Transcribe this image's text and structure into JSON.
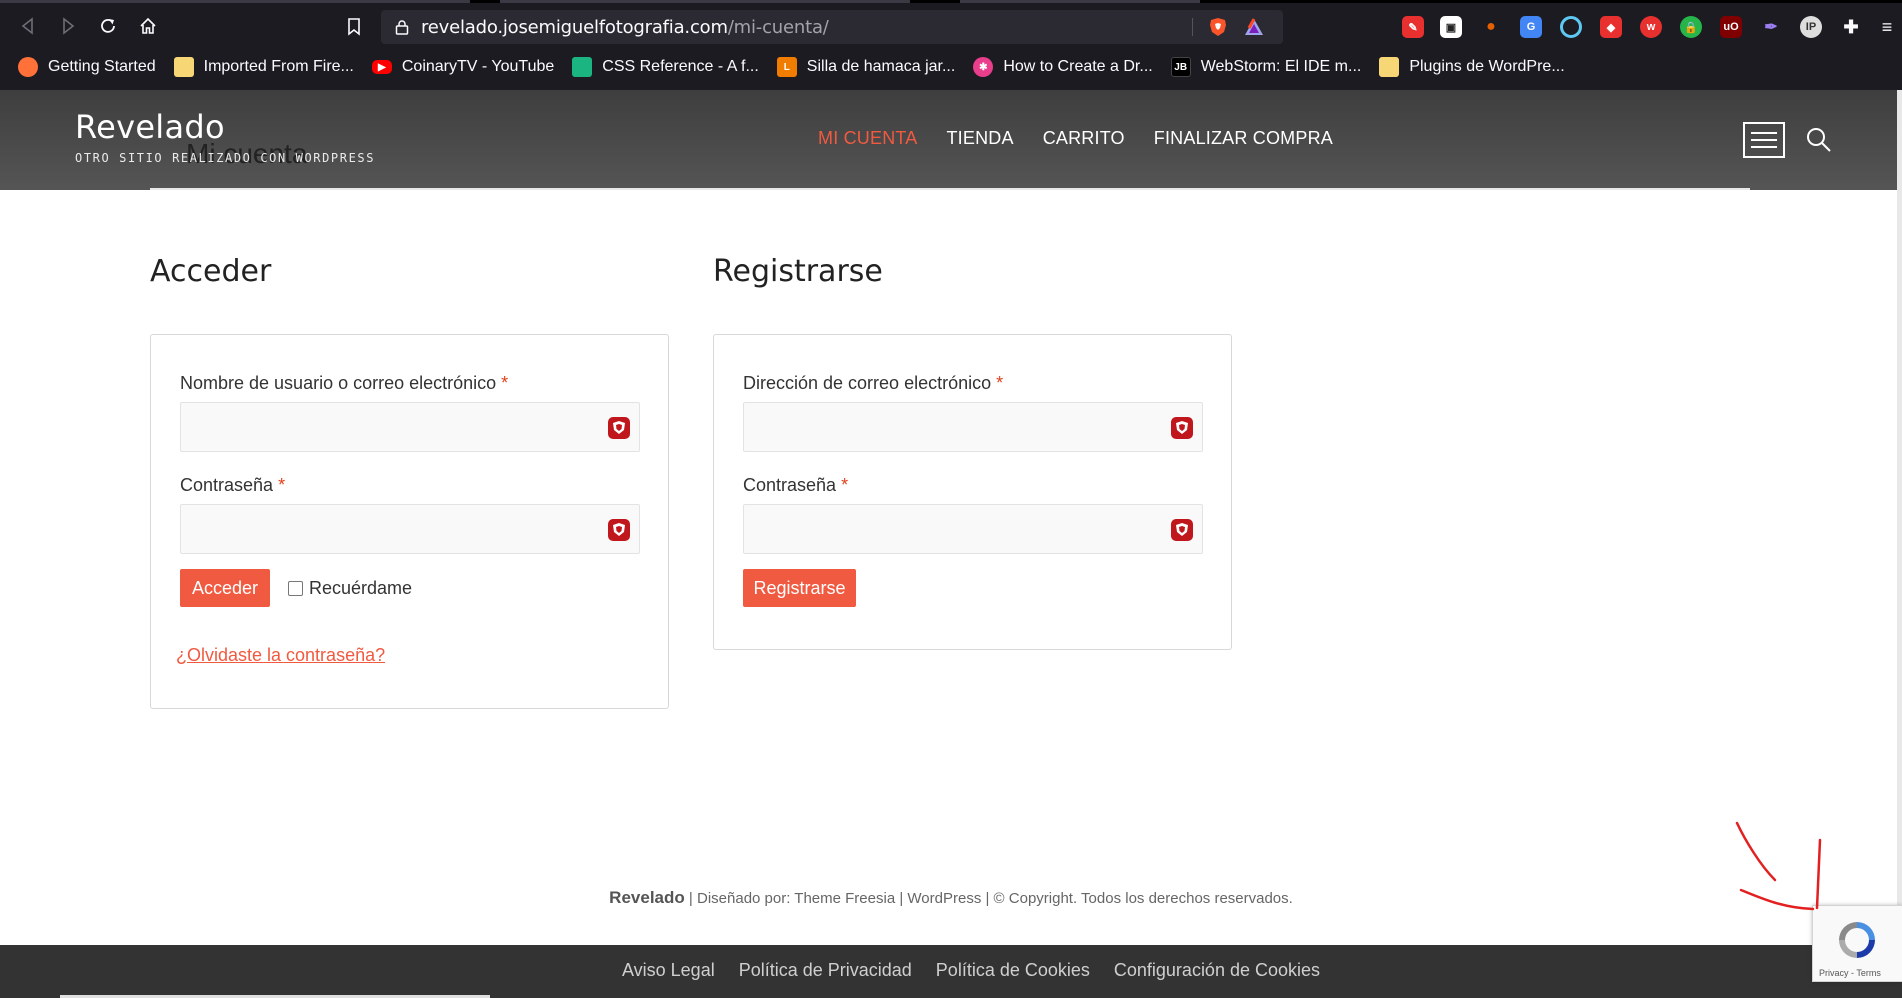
{
  "browser": {
    "url_domain": "revelado.josemiguelfotografia.com",
    "url_path": "/mi-cuenta/",
    "bookmarks": [
      {
        "label": "Getting Started",
        "icon": "firefox-icon",
        "color": "#ff7139"
      },
      {
        "label": "Imported From Fire...",
        "icon": "folder-icon",
        "color": "#f7d775"
      },
      {
        "label": "CoinaryTV - YouTube",
        "icon": "youtube-icon",
        "color": "#ff0000"
      },
      {
        "label": "CSS Reference - A f...",
        "icon": "css-icon",
        "color": "#1bb582"
      },
      {
        "label": "Silla de hamaca jar...",
        "icon": "leroy-icon",
        "color": "#f07d00"
      },
      {
        "label": "How to Create a Dr...",
        "icon": "asterisk-icon",
        "color": "#e83e8c"
      },
      {
        "label": "WebStorm: El IDE m...",
        "icon": "jetbrains-icon",
        "color": "#000000"
      },
      {
        "label": "Plugins de WordPre...",
        "icon": "folder-icon",
        "color": "#f7d775"
      }
    ]
  },
  "site": {
    "title": "Revelado",
    "tagline": "OTRO SITIO REALIZADO CON WORDPRESS",
    "page_title": "Mi cuenta",
    "nav": [
      "MI CUENTA",
      "TIENDA",
      "CARRITO",
      "FINALIZAR COMPRA"
    ],
    "accent": "#f05a40"
  },
  "login": {
    "heading": "Acceder",
    "username_label": "Nombre de usuario o correo electrónico",
    "password_label": "Contraseña",
    "required_mark": "*",
    "submit": "Acceder",
    "remember": "Recuérdame",
    "lost_password": "¿Olvidaste la contraseña?"
  },
  "register": {
    "heading": "Registrarse",
    "email_label": "Dirección de correo electrónico",
    "password_label": "Contraseña",
    "required_mark": "*",
    "submit": "Registrarse"
  },
  "footer": {
    "site_name": "Revelado",
    "designed_by": " | Diseñado por: ",
    "theme": "Theme Freesia",
    "sep": " | ",
    "wordpress": "WordPress",
    "copyright": " | © Copyright. Todos los derechos reservados.",
    "links": [
      "Aviso Legal",
      "Política de Privacidad",
      "Política de Cookies",
      "Configuración de Cookies"
    ]
  },
  "recaptcha": {
    "terms": "Privacy - Terms"
  }
}
